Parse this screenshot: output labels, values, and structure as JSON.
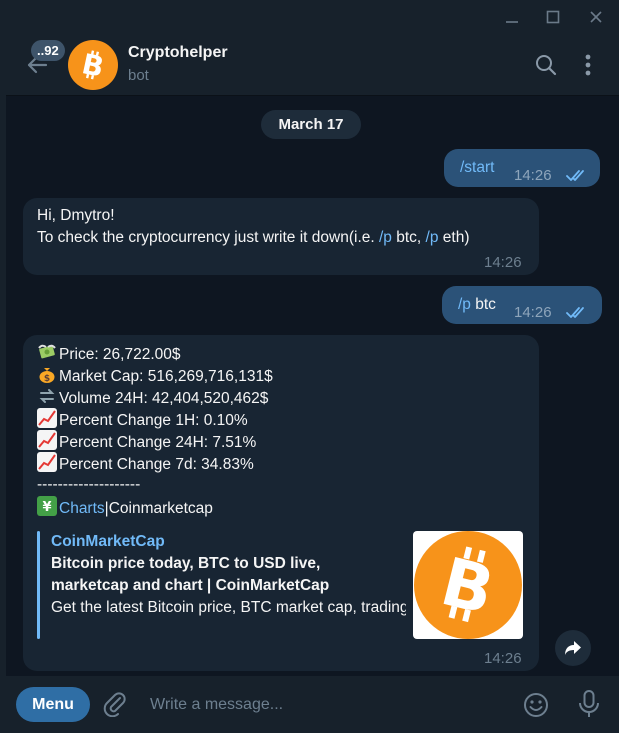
{
  "window": {
    "minimize_glyph": "—",
    "maximize_glyph": "☐",
    "close_glyph": "✕"
  },
  "header": {
    "unread_count": "..92",
    "title": "Cryptohelper",
    "subtitle": "bot",
    "avatar_icon": "bitcoin-icon",
    "accent": "#f7931a"
  },
  "date_separator": "March 17",
  "messages": [
    {
      "id": "m1",
      "direction": "out",
      "text": "/start",
      "time": "14:26",
      "status": "read"
    },
    {
      "id": "m2",
      "direction": "in",
      "greeting": "Hi, Dmytro!",
      "text_before": "To check the cryptocurrency just write it down(i.e. ",
      "cmd1": "/p",
      "text_mid": " btc, ",
      "cmd2": "/p",
      "text_after": " eth)",
      "time": "14:26"
    },
    {
      "id": "m3",
      "direction": "out",
      "cmd": "/p",
      "arg": " btc",
      "time": "14:26",
      "status": "read"
    },
    {
      "id": "m4",
      "direction": "in",
      "lines": [
        {
          "icon": "money-with-wings-icon",
          "text": "Price: 26,722.00$"
        },
        {
          "icon": "money-bag-icon",
          "text": "Market Cap: 516,269,716,131$"
        },
        {
          "icon": "exchange-icon",
          "text": "Volume 24H: 42,404,520,462$"
        },
        {
          "icon": "chart-increasing-icon",
          "text": "Percent Change 1H: 0.10%"
        },
        {
          "icon": "chart-increasing-icon",
          "text": "Percent Change 24H: 7.51%"
        },
        {
          "icon": "chart-increasing-icon",
          "text": "Percent Change 7d: 34.83%"
        }
      ],
      "separator": "--------------------",
      "links_icon": "currency-exchange-icon",
      "link_charts": "Charts",
      "link_sep": "|",
      "link_cmc": "Coinmarketcap",
      "preview": {
        "site": "CoinMarketCap",
        "title": "Bitcoin price today, BTC to USD live, marketcap and chart | CoinMarketCap",
        "description": "Get the latest Bitcoin price, BTC market cap, trading pairs, charts and data today from the ...",
        "image_icon": "bitcoin-icon"
      },
      "time": "14:26"
    }
  ],
  "composer": {
    "menu_label": "Menu",
    "placeholder": "Write a message..."
  },
  "colors": {
    "background": "#0e1621",
    "panel": "#17212b",
    "outgoing_bubble": "#2b5278",
    "incoming_bubble": "#182533",
    "link": "#71baf8",
    "menu_button": "#2f6ea5"
  }
}
